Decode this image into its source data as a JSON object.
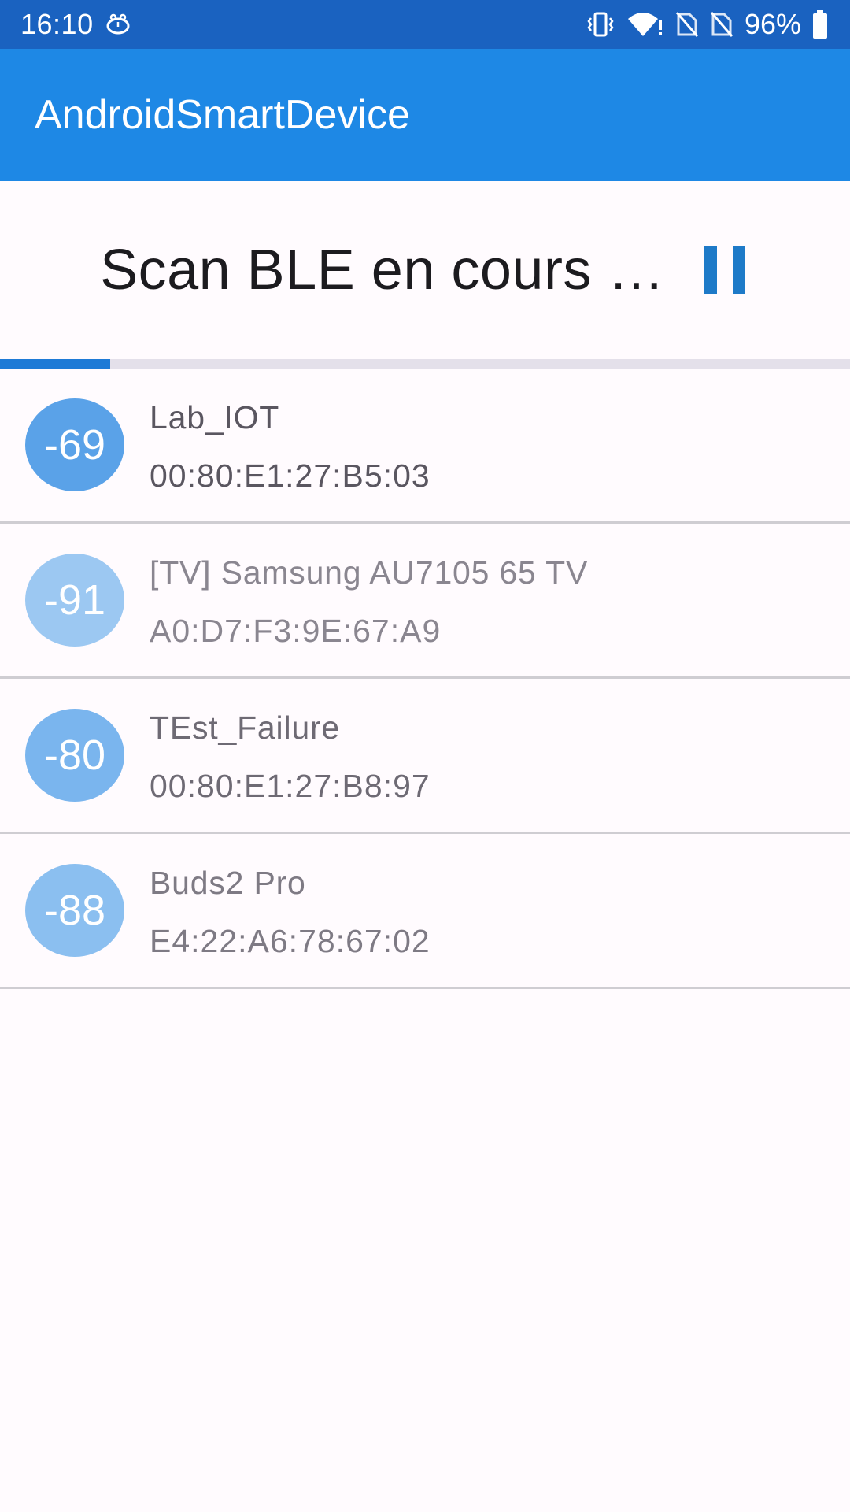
{
  "status_bar": {
    "time": "16:10",
    "battery_pct": "96%",
    "icons": [
      "alarm-icon",
      "vibrate-icon",
      "wifi-icon",
      "no-sim-icon",
      "no-sim-icon",
      "battery-icon"
    ]
  },
  "app_bar": {
    "title": "AndroidSmartDevice"
  },
  "scan": {
    "title": "Scan BLE en cours …",
    "control_icon": "pause-icon",
    "progress": 0.13
  },
  "devices": [
    {
      "rssi": "-69",
      "name": "Lab_IOT",
      "mac": "00:80:E1:27:B5:03",
      "badge_color": "#5aa2e8",
      "text_color": "#5a5660"
    },
    {
      "rssi": "-91",
      "name": "[TV] Samsung AU7105 65 TV",
      "mac": "A0:D7:F3:9E:67:A9",
      "badge_color": "#9cc8f2",
      "text_color": "#8a8690"
    },
    {
      "rssi": "-80",
      "name": "TEst_Failure",
      "mac": "00:80:E1:27:B8:97",
      "badge_color": "#7ab5ee",
      "text_color": "#6e6a74"
    },
    {
      "rssi": "-88",
      "name": "Buds2 Pro",
      "mac": "E4:22:A6:78:67:02",
      "badge_color": "#8bbff0",
      "text_color": "#7e7a84"
    }
  ],
  "colors": {
    "status_bar": "#1a62c0",
    "app_bar": "#1e88e5",
    "accent": "#1e7ad6"
  }
}
